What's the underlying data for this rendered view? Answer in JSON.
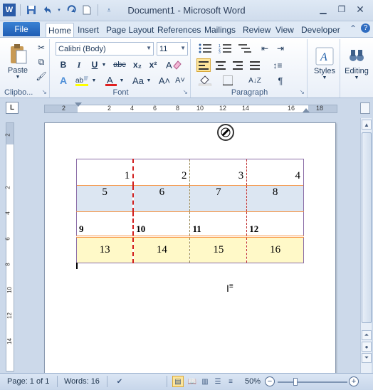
{
  "window": {
    "title": "Document1 - Microsoft Word"
  },
  "qat": {
    "icons": [
      "word-icon",
      "save-icon",
      "undo-icon",
      "redo-icon",
      "new-doc-icon",
      "customize-qat-icon"
    ]
  },
  "tabs": {
    "file": "File",
    "items": [
      "Home",
      "Insert",
      "Page Layout",
      "References",
      "Mailings",
      "Review",
      "View",
      "Developer"
    ],
    "active": "Home"
  },
  "ribbon": {
    "clipboard": {
      "label": "Clipbo...",
      "paste": "Paste"
    },
    "font": {
      "label": "Font",
      "family": "Calibri (Body)",
      "size": "11",
      "bold": "B",
      "italic": "I",
      "underline": "U",
      "strike": "abc",
      "subscript": "x₂",
      "superscript": "x²",
      "grow": "A˄",
      "shrink": "A˅",
      "case": "Aa",
      "clear": "A"
    },
    "paragraph": {
      "label": "Paragraph",
      "pilcrow": "¶"
    },
    "styles": {
      "label": "Styles"
    },
    "editing": {
      "label": "Editing"
    }
  },
  "ruler": {
    "tab_selector": "L",
    "numbers": [
      "2",
      "2",
      "4",
      "6",
      "8",
      "10",
      "12",
      "14",
      "16",
      "18"
    ]
  },
  "vruler": {
    "numbers": [
      "2",
      "2",
      "4",
      "6",
      "8",
      "10",
      "12",
      "14"
    ]
  },
  "table": {
    "rows": [
      [
        "1",
        "2",
        "3",
        "4"
      ],
      [
        "5",
        "6",
        "7",
        "8"
      ],
      [
        "9",
        "10",
        "11",
        "12"
      ],
      [
        "13",
        "14",
        "15",
        "16"
      ]
    ]
  },
  "status": {
    "page": "Page: 1 of 1",
    "words": "Words: 16",
    "zoom": "50%",
    "zoom_minus": "−",
    "zoom_plus": "+",
    "zoom_level": 0.5
  },
  "colors": {
    "accent": "#2b579a",
    "file_tab": "#2a67bd",
    "row_blue": "#dce6f2",
    "row_yellow": "#fff9c8",
    "orange_border": "#f79646",
    "red_dash": "#d01c1c"
  }
}
